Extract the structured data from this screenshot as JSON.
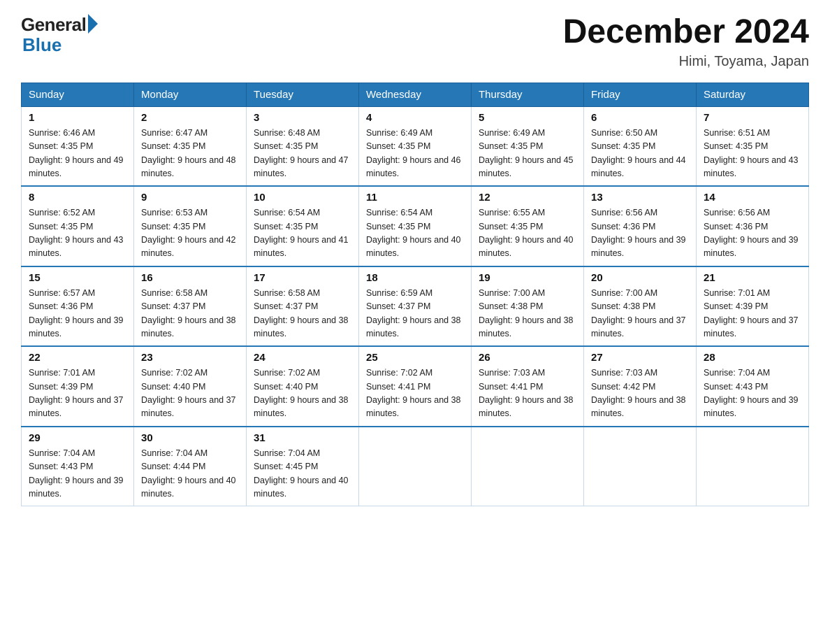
{
  "header": {
    "logo_general": "General",
    "logo_blue": "Blue",
    "month_title": "December 2024",
    "location": "Himi, Toyama, Japan"
  },
  "days_of_week": [
    "Sunday",
    "Monday",
    "Tuesday",
    "Wednesday",
    "Thursday",
    "Friday",
    "Saturday"
  ],
  "weeks": [
    [
      {
        "num": "1",
        "sunrise": "6:46 AM",
        "sunset": "4:35 PM",
        "daylight": "9 hours and 49 minutes."
      },
      {
        "num": "2",
        "sunrise": "6:47 AM",
        "sunset": "4:35 PM",
        "daylight": "9 hours and 48 minutes."
      },
      {
        "num": "3",
        "sunrise": "6:48 AM",
        "sunset": "4:35 PM",
        "daylight": "9 hours and 47 minutes."
      },
      {
        "num": "4",
        "sunrise": "6:49 AM",
        "sunset": "4:35 PM",
        "daylight": "9 hours and 46 minutes."
      },
      {
        "num": "5",
        "sunrise": "6:49 AM",
        "sunset": "4:35 PM",
        "daylight": "9 hours and 45 minutes."
      },
      {
        "num": "6",
        "sunrise": "6:50 AM",
        "sunset": "4:35 PM",
        "daylight": "9 hours and 44 minutes."
      },
      {
        "num": "7",
        "sunrise": "6:51 AM",
        "sunset": "4:35 PM",
        "daylight": "9 hours and 43 minutes."
      }
    ],
    [
      {
        "num": "8",
        "sunrise": "6:52 AM",
        "sunset": "4:35 PM",
        "daylight": "9 hours and 43 minutes."
      },
      {
        "num": "9",
        "sunrise": "6:53 AM",
        "sunset": "4:35 PM",
        "daylight": "9 hours and 42 minutes."
      },
      {
        "num": "10",
        "sunrise": "6:54 AM",
        "sunset": "4:35 PM",
        "daylight": "9 hours and 41 minutes."
      },
      {
        "num": "11",
        "sunrise": "6:54 AM",
        "sunset": "4:35 PM",
        "daylight": "9 hours and 40 minutes."
      },
      {
        "num": "12",
        "sunrise": "6:55 AM",
        "sunset": "4:35 PM",
        "daylight": "9 hours and 40 minutes."
      },
      {
        "num": "13",
        "sunrise": "6:56 AM",
        "sunset": "4:36 PM",
        "daylight": "9 hours and 39 minutes."
      },
      {
        "num": "14",
        "sunrise": "6:56 AM",
        "sunset": "4:36 PM",
        "daylight": "9 hours and 39 minutes."
      }
    ],
    [
      {
        "num": "15",
        "sunrise": "6:57 AM",
        "sunset": "4:36 PM",
        "daylight": "9 hours and 39 minutes."
      },
      {
        "num": "16",
        "sunrise": "6:58 AM",
        "sunset": "4:37 PM",
        "daylight": "9 hours and 38 minutes."
      },
      {
        "num": "17",
        "sunrise": "6:58 AM",
        "sunset": "4:37 PM",
        "daylight": "9 hours and 38 minutes."
      },
      {
        "num": "18",
        "sunrise": "6:59 AM",
        "sunset": "4:37 PM",
        "daylight": "9 hours and 38 minutes."
      },
      {
        "num": "19",
        "sunrise": "7:00 AM",
        "sunset": "4:38 PM",
        "daylight": "9 hours and 38 minutes."
      },
      {
        "num": "20",
        "sunrise": "7:00 AM",
        "sunset": "4:38 PM",
        "daylight": "9 hours and 37 minutes."
      },
      {
        "num": "21",
        "sunrise": "7:01 AM",
        "sunset": "4:39 PM",
        "daylight": "9 hours and 37 minutes."
      }
    ],
    [
      {
        "num": "22",
        "sunrise": "7:01 AM",
        "sunset": "4:39 PM",
        "daylight": "9 hours and 37 minutes."
      },
      {
        "num": "23",
        "sunrise": "7:02 AM",
        "sunset": "4:40 PM",
        "daylight": "9 hours and 37 minutes."
      },
      {
        "num": "24",
        "sunrise": "7:02 AM",
        "sunset": "4:40 PM",
        "daylight": "9 hours and 38 minutes."
      },
      {
        "num": "25",
        "sunrise": "7:02 AM",
        "sunset": "4:41 PM",
        "daylight": "9 hours and 38 minutes."
      },
      {
        "num": "26",
        "sunrise": "7:03 AM",
        "sunset": "4:41 PM",
        "daylight": "9 hours and 38 minutes."
      },
      {
        "num": "27",
        "sunrise": "7:03 AM",
        "sunset": "4:42 PM",
        "daylight": "9 hours and 38 minutes."
      },
      {
        "num": "28",
        "sunrise": "7:04 AM",
        "sunset": "4:43 PM",
        "daylight": "9 hours and 39 minutes."
      }
    ],
    [
      {
        "num": "29",
        "sunrise": "7:04 AM",
        "sunset": "4:43 PM",
        "daylight": "9 hours and 39 minutes."
      },
      {
        "num": "30",
        "sunrise": "7:04 AM",
        "sunset": "4:44 PM",
        "daylight": "9 hours and 40 minutes."
      },
      {
        "num": "31",
        "sunrise": "7:04 AM",
        "sunset": "4:45 PM",
        "daylight": "9 hours and 40 minutes."
      },
      null,
      null,
      null,
      null
    ]
  ]
}
